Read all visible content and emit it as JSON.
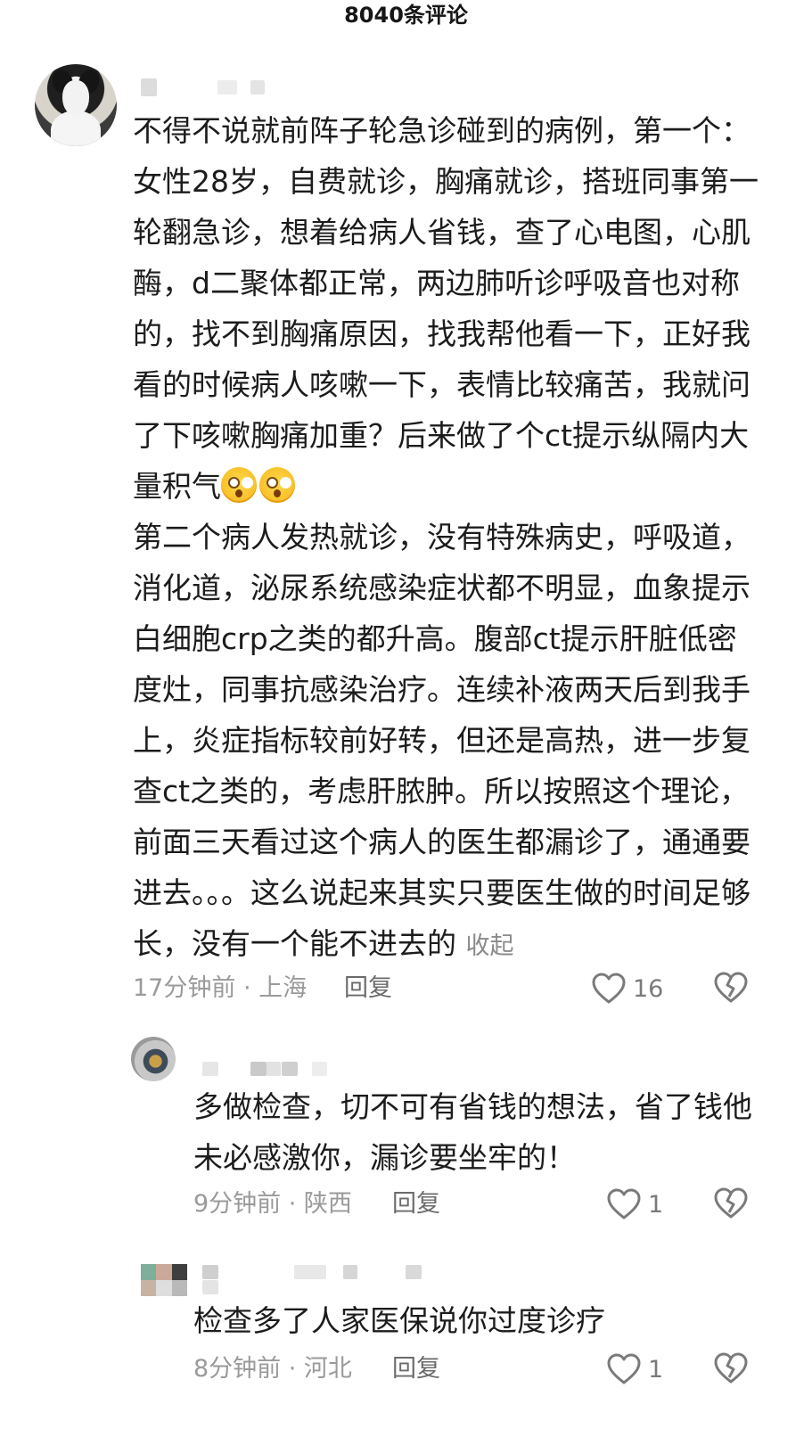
{
  "header": {
    "title": "8040条评论"
  },
  "comments": [
    {
      "paragraphs": [
        "不得不说就前阵子轮急诊碰到的病例，第一个：女性28岁，自费就诊，胸痛就诊，搭班同事第一轮翻急诊，想着给病人省钱，查了心电图，心肌酶，d二聚体都正常，两边肺听诊呼吸音也对称的，找不到胸痛原因，找我帮他看一下，正好我看的时候病人咳嗽一下，表情比较痛苦，我就问了下咳嗽胸痛加重？后来做了个ct提示纵隔内大量积气",
        "第二个病人发热就诊，没有特殊病史，呼吸道，消化道，泌尿系统感染症状都不明显，血象提示白细胞crp之类的都升高。腹部ct提示肝脏低密度灶，同事抗感染治疗。连续补液两天后到我手上，炎症指标较前好转，但还是高热，进一步复查ct之类的，考虑肝脓肿。所以按照这个理论，前面三天看过这个病人的医生都漏诊了，通通要进去。。。这么说起来其实只要医生做的时间足够长，没有一个能不进去的"
      ],
      "emoji_names": [
        "astonished-emoji",
        "astonished-emoji"
      ],
      "collapse_label": "收起",
      "time": "17分钟前",
      "location": "上海",
      "time_location": "17分钟前 · 上海",
      "reply_label": "回复",
      "likes": "16"
    }
  ],
  "replies": [
    {
      "text": "多做检查，切不可有省钱的想法，省了钱他未必感激你，漏诊要坐牢的！",
      "time_location": "9分钟前 · 陕西",
      "reply_label": "回复",
      "likes": "1"
    },
    {
      "text": "检查多了人家医保说你过度诊疗",
      "time_location": "8分钟前 · 河北",
      "reply_label": "回复",
      "likes": "1"
    }
  ],
  "icons": {
    "like": "heart-outline-icon",
    "dislike": "broken-heart-icon"
  },
  "colors": {
    "text": "#1c1c1c",
    "meta": "#9a9a9a",
    "reply": "#6b6b6b",
    "icon": "#7a7a7a"
  }
}
